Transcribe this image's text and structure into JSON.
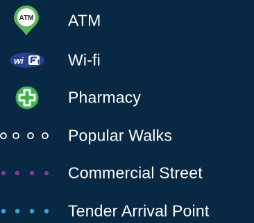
{
  "background_color": "#082843",
  "items": [
    {
      "label": "ATM",
      "icon": "atm-pin-icon",
      "icon_text": "ATM",
      "color": "#5cb85c"
    },
    {
      "label": "Wi-fi",
      "icon": "wifi-icon",
      "icon_text": "wi",
      "color": "#2b3f8f"
    },
    {
      "label": "Pharmacy",
      "icon": "pharmacy-cross-icon",
      "color": "#3db54a"
    },
    {
      "label": "Popular Walks",
      "icon": "hollow-dots-icon",
      "color": "#ffffff"
    },
    {
      "label": "Commercial Street",
      "icon": "purple-dots-icon",
      "color": "#7d3c98"
    },
    {
      "label": "Tender Arrival Point",
      "icon": "blue-dots-icon",
      "color": "#2fa8e0"
    }
  ]
}
